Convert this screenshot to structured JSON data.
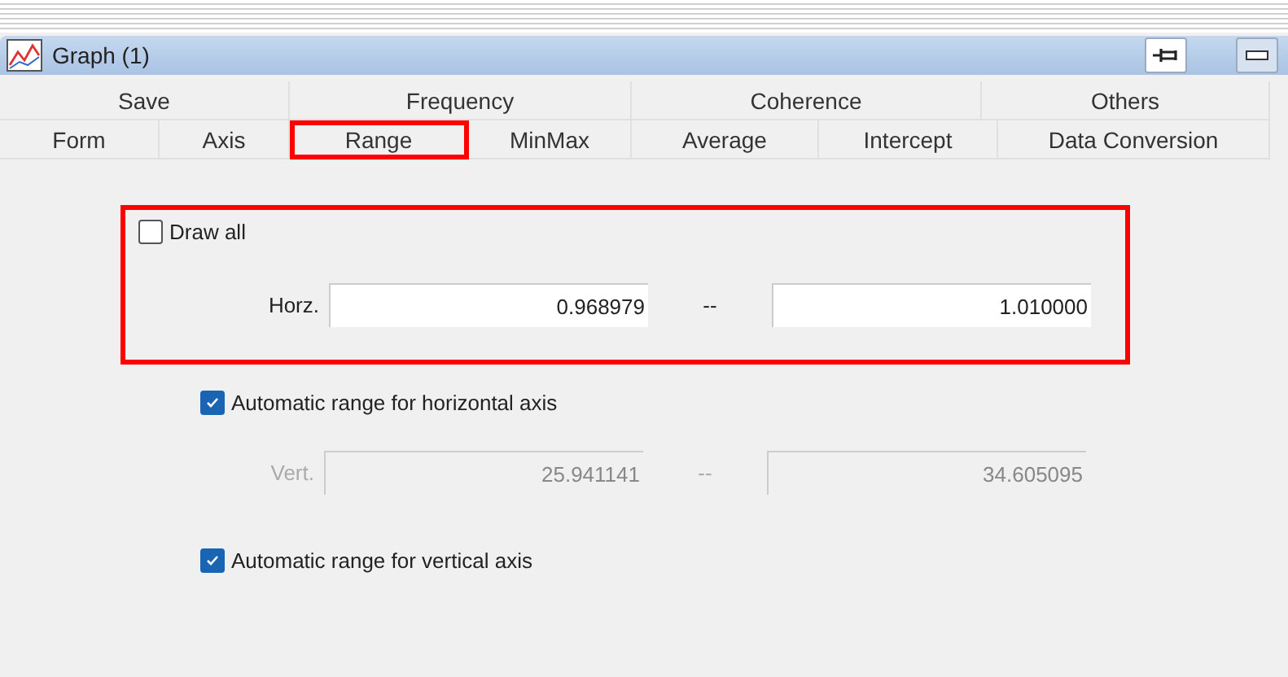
{
  "window": {
    "title": "Graph (1)"
  },
  "tab_rows": [
    [
      {
        "label": "Save",
        "selected": false
      },
      {
        "label": "Frequency",
        "selected": false
      },
      {
        "label": "Coherence",
        "selected": false
      },
      {
        "label": "Others",
        "selected": false
      }
    ],
    [
      {
        "label": "Form",
        "selected": false
      },
      {
        "label": "Axis",
        "selected": false
      },
      {
        "label": "Range",
        "selected": true
      },
      {
        "label": "MinMax",
        "selected": false
      },
      {
        "label": "Average",
        "selected": false
      },
      {
        "label": "Intercept",
        "selected": false
      },
      {
        "label": "Data Conversion",
        "selected": false
      }
    ]
  ],
  "draw_all": {
    "label": "Draw all",
    "checked": false
  },
  "horizontal": {
    "label": "Horz.",
    "from": "0.968979",
    "separator": "--",
    "to": "1.010000",
    "disabled": false
  },
  "auto_horizontal": {
    "label": "Automatic range for horizontal axis",
    "checked": true
  },
  "vertical": {
    "label": "Vert.",
    "from": "25.941141",
    "separator": "--",
    "to": "34.605095",
    "disabled": true
  },
  "auto_vertical": {
    "label": "Automatic range for vertical axis",
    "checked": true
  }
}
